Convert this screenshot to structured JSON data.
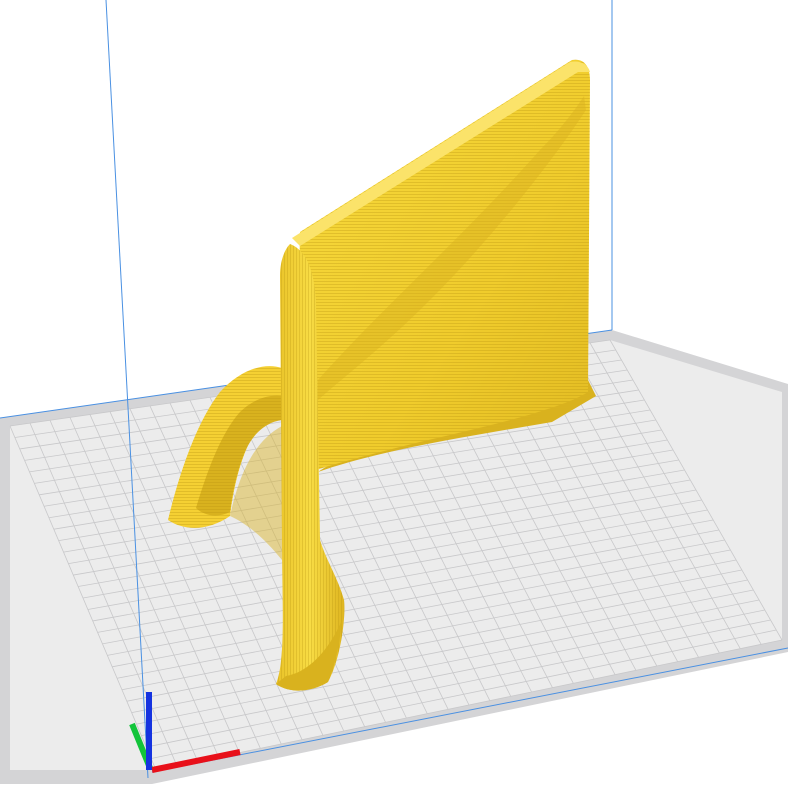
{
  "viewport": {
    "background_color": "#ffffff",
    "camera_mode": "perspective"
  },
  "build_volume": {
    "plate_color": "#ececec",
    "plate_edge_color": "#d4d4d6",
    "grid_line_color": "#c8c8ca",
    "volume_edge_color": "#4a90e2",
    "show_grid": true
  },
  "model": {
    "color": "#f5d033",
    "shade_color": "#d9b21e",
    "highlight_color": "#fbe36a",
    "selected": false
  },
  "axis_gizmo": {
    "x_axis_color": "#e8101a",
    "y_axis_color": "#12c43a",
    "z_axis_color": "#1533e0"
  }
}
